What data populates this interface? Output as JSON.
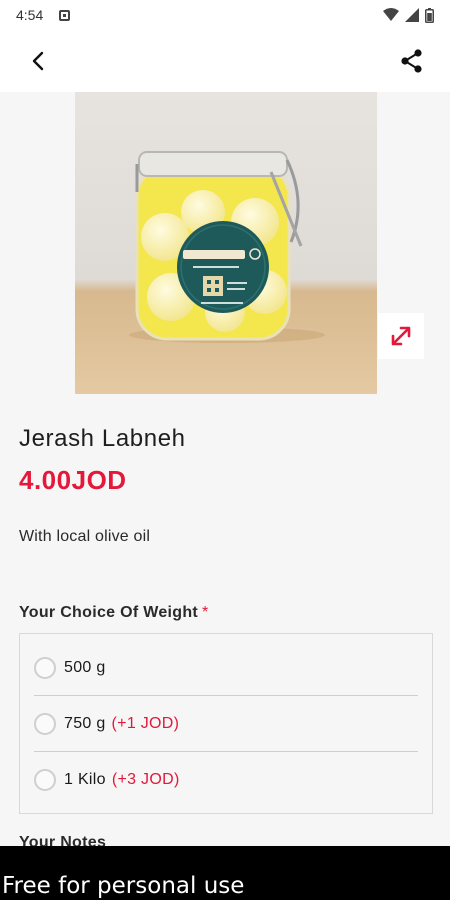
{
  "status_bar": {
    "time": "4:54",
    "icons": [
      "notification-icon",
      "wifi-icon",
      "signal-icon",
      "battery-icon"
    ]
  },
  "app_bar": {
    "back_icon": "back-arrow-icon",
    "share_icon": "share-icon"
  },
  "product": {
    "title": "Jerash Labneh",
    "price": "4.00JOD",
    "description": "With local olive oil",
    "image_alt": "glass jar of labneh balls in olive oil",
    "expand_icon": "expand-icon"
  },
  "weight_section": {
    "title": "Your Choice Of Weight",
    "required_mark": "*",
    "options": [
      {
        "label": "500 g",
        "extra": ""
      },
      {
        "label": "750 g",
        "extra": "(+1 JOD)"
      },
      {
        "label": "1 Kilo",
        "extra": "(+3 JOD)"
      }
    ]
  },
  "notes_section": {
    "title": "Your Notes"
  },
  "banner": {
    "text": "Free for personal use"
  },
  "colors": {
    "accent": "#e4183a",
    "background": "#f6f6f6",
    "surface": "#ffffff"
  }
}
